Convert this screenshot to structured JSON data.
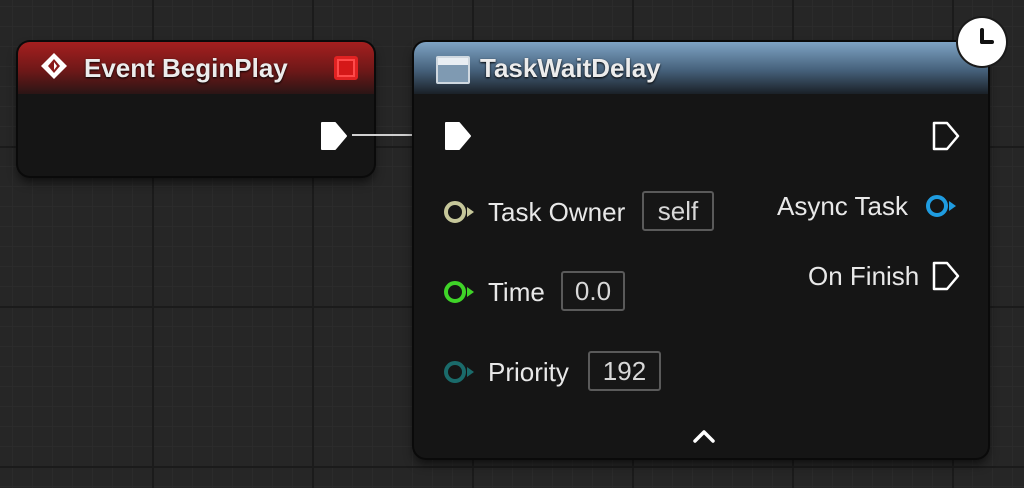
{
  "event_node": {
    "title": "Event BeginPlay",
    "icons": [
      "event-icon",
      "stop-icon",
      "exec-out-pin"
    ]
  },
  "task_node": {
    "title": "TaskWaitDelay",
    "icons": [
      "function-icon",
      "exec-in-pin",
      "exec-out-pin",
      "collapse-chevron-icon",
      "clock-icon"
    ],
    "inputs": [
      {
        "label": "Task Owner",
        "value": "self",
        "color": "#c6c79a"
      },
      {
        "label": "Time",
        "value": "0.0",
        "color": "#3fd428"
      },
      {
        "label": "Priority",
        "value": "192",
        "color": "#1a6b6b"
      }
    ],
    "outputs": [
      {
        "label": "Async Task",
        "color": "#1f9ce0"
      },
      {
        "label": "On Finish",
        "color": "#ffffff"
      }
    ]
  }
}
